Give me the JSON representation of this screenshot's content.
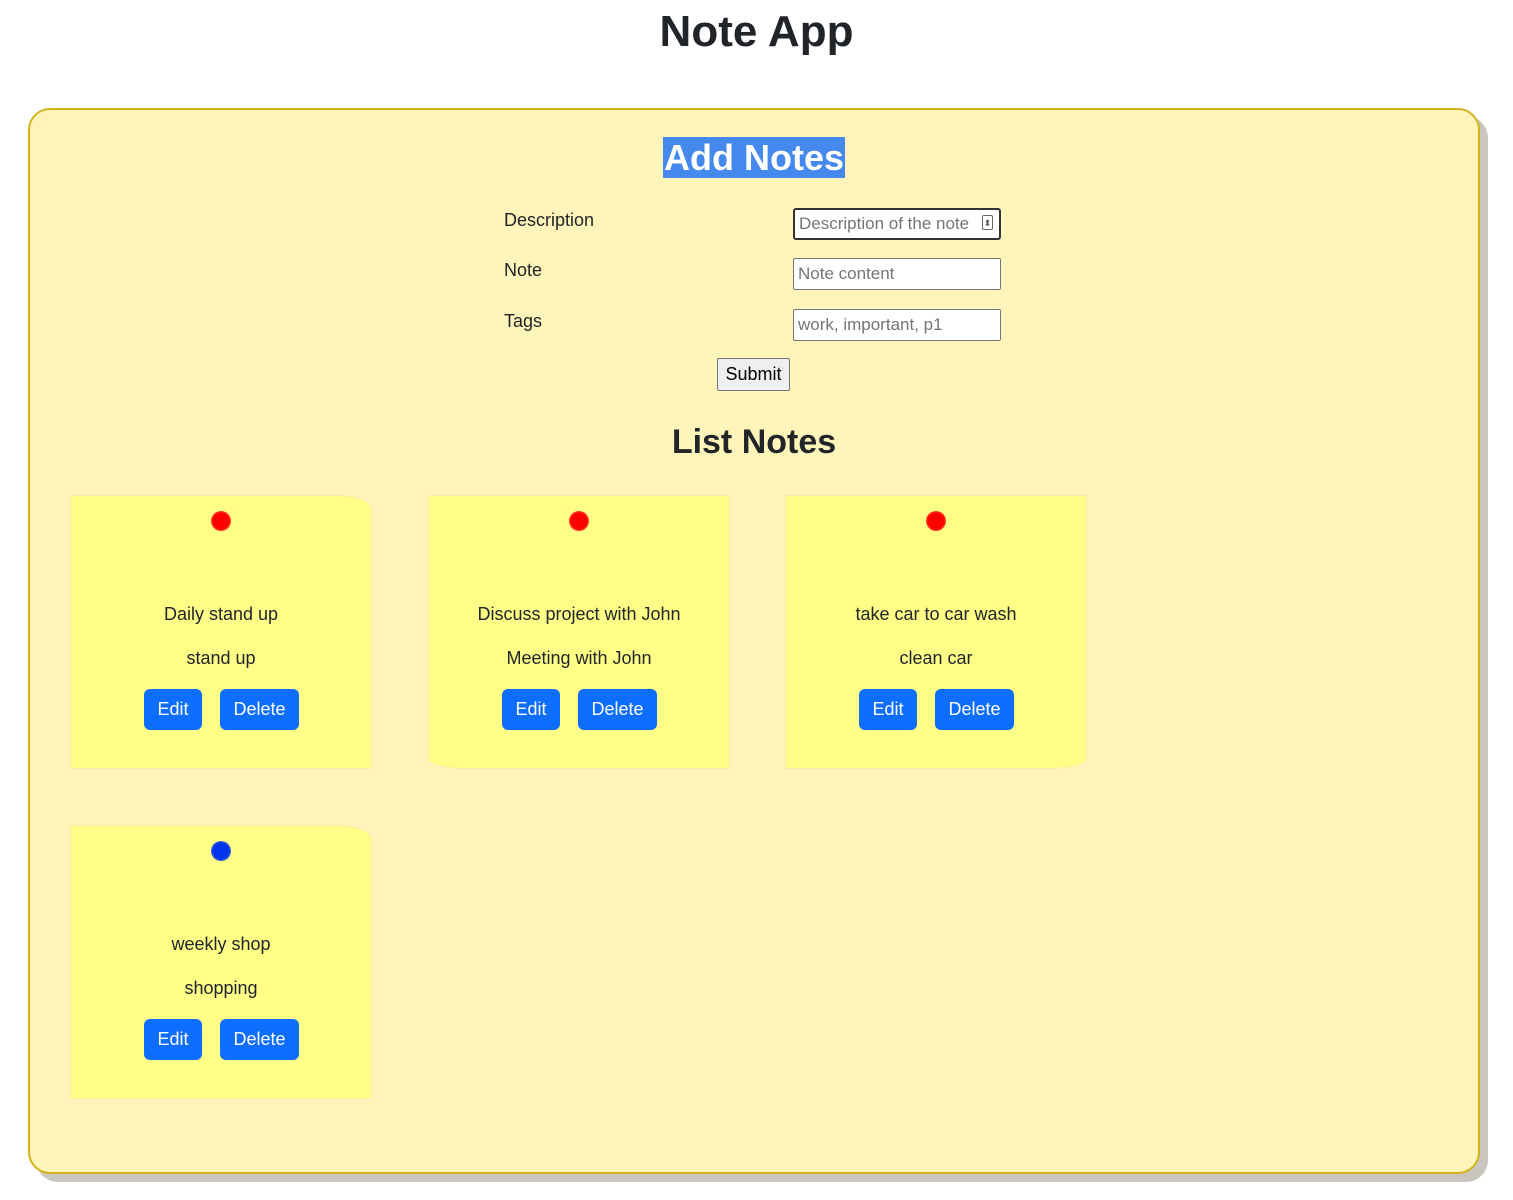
{
  "app": {
    "title": "Note App"
  },
  "add_section": {
    "title": "Add Notes",
    "fields": [
      {
        "label": "Description",
        "placeholder": "Description of the note",
        "value": ""
      },
      {
        "label": "Note",
        "placeholder": "Note content",
        "value": ""
      },
      {
        "label": "Tags",
        "placeholder": "work, important, p1",
        "value": ""
      }
    ],
    "submit_label": "Submit"
  },
  "list_section": {
    "title": "List Notes",
    "notes": [
      {
        "description": "Daily stand up",
        "content": "stand up",
        "pin_color": "#ff0000",
        "edit_label": "Edit",
        "delete_label": "Delete"
      },
      {
        "description": "Discuss project with John",
        "content": "Meeting with John",
        "pin_color": "#ff0000",
        "edit_label": "Edit",
        "delete_label": "Delete"
      },
      {
        "description": "take car to car wash",
        "content": "clean car",
        "pin_color": "#ff0000",
        "edit_label": "Edit",
        "delete_label": "Delete"
      },
      {
        "description": "weekly shop",
        "content": "shopping",
        "pin_color": "#0033ee",
        "edit_label": "Edit",
        "delete_label": "Delete"
      }
    ]
  },
  "colors": {
    "board_background": "#fff4b9",
    "board_border": "#d4b21c",
    "note_background": "#ffff88",
    "button_primary": "#0d6efd",
    "heading_highlight": "#4589ef"
  }
}
